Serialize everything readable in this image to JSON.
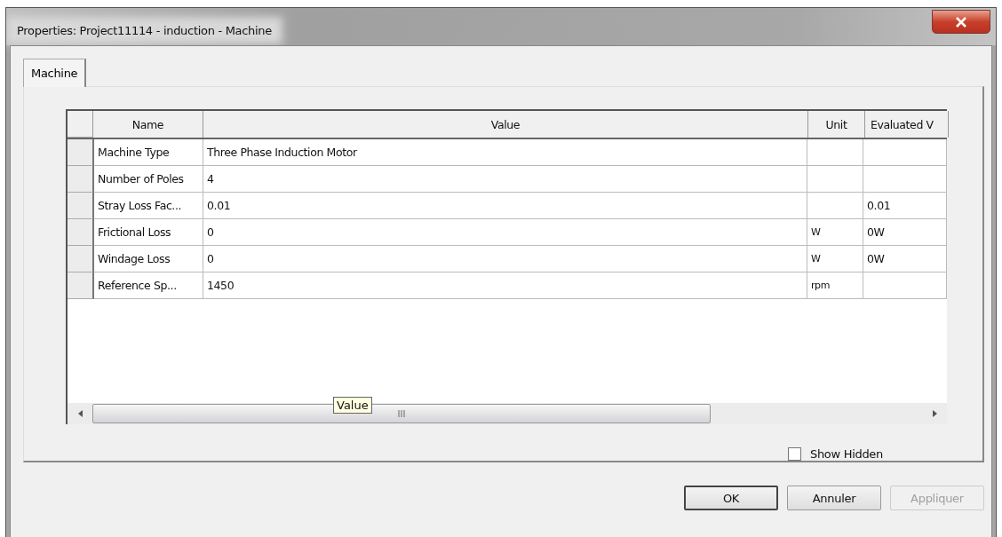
{
  "window": {
    "title": "Properties: Project11114 - induction - Machine"
  },
  "tabs": [
    {
      "label": "Machine",
      "selected": true
    }
  ],
  "table": {
    "columns": [
      "Name",
      "Value",
      "Unit",
      "Evaluated V"
    ],
    "rows": [
      {
        "cells": [
          "Machine Type",
          "Three Phase Induction Motor",
          "",
          ""
        ]
      },
      {
        "cells": [
          "Number of Poles",
          "4",
          "",
          ""
        ]
      },
      {
        "cells": [
          "Stray Loss Fac...",
          "0.01",
          "",
          "0.01"
        ]
      },
      {
        "cells": [
          "Frictional Loss",
          "0",
          "W",
          "0W"
        ]
      },
      {
        "cells": [
          "Windage Loss",
          "0",
          "W",
          "0W"
        ]
      },
      {
        "cells": [
          "Reference Sp...",
          "1450",
          "rpm",
          ""
        ]
      }
    ]
  },
  "tooltip": "Value",
  "show_hidden": {
    "label": "Show Hidden",
    "checked": false
  },
  "buttons": [
    {
      "label": "OK",
      "disabled": false,
      "default": true
    },
    {
      "label": "Annuler",
      "disabled": false,
      "default": false
    },
    {
      "label": "Appliquer",
      "disabled": true,
      "default": false
    }
  ]
}
